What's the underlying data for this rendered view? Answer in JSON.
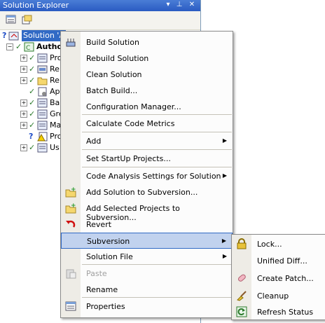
{
  "window": {
    "title": "Solution Explorer",
    "pin": "▾",
    "autohide": "⊥",
    "close": "✕"
  },
  "toolbar": {
    "properties_icon": "properties-icon",
    "show_all_icon": "show-all-files-icon"
  },
  "tree": {
    "root_label": "Solution 'A",
    "project_label": "Autho",
    "items": [
      {
        "label": "Pro",
        "icon": "properties-folder-icon",
        "expander": "+"
      },
      {
        "label": "Re",
        "icon": "references-icon",
        "expander": "+"
      },
      {
        "label": "Re",
        "icon": "folder-icon",
        "expander": "+"
      },
      {
        "label": "Ap",
        "icon": "config-file-icon",
        "expander": ""
      },
      {
        "label": "Ba",
        "icon": "class-file-icon",
        "expander": "+"
      },
      {
        "label": "Gre",
        "icon": "class-file-icon",
        "expander": "+"
      },
      {
        "label": "Ma",
        "icon": "class-file-icon",
        "expander": "+"
      },
      {
        "label": "Pro",
        "icon": "warning-file-icon",
        "expander": ""
      },
      {
        "label": "Us",
        "icon": "class-file-icon",
        "expander": "+"
      }
    ]
  },
  "context_menu": {
    "items": [
      {
        "label": "Build Solution",
        "icon": "build-icon"
      },
      {
        "label": "Rebuild Solution",
        "icon": ""
      },
      {
        "label": "Clean Solution",
        "icon": ""
      },
      {
        "label": "Batch Build...",
        "icon": ""
      },
      {
        "label": "Configuration Manager...",
        "icon": ""
      },
      {
        "label": "Calculate Code Metrics",
        "icon": ""
      },
      {
        "label": "Add",
        "icon": ""
      },
      {
        "label": "Set StartUp Projects...",
        "icon": ""
      },
      {
        "label": "Code Analysis Settings for Solution",
        "icon": ""
      },
      {
        "label": "Add Solution to Subversion...",
        "icon": "add-subversion-icon"
      },
      {
        "label": "Add Selected Projects to Subversion...",
        "icon": "add-subversion-icon"
      },
      {
        "label": "Revert",
        "icon": "revert-icon"
      },
      {
        "label": "Subversion",
        "icon": ""
      },
      {
        "label": "Solution File",
        "icon": ""
      },
      {
        "label": "Paste",
        "icon": "paste-icon"
      },
      {
        "label": "Rename",
        "icon": ""
      },
      {
        "label": "Properties",
        "icon": "properties-icon"
      }
    ]
  },
  "submenu": {
    "items": [
      {
        "label": "Lock...",
        "icon": "lock-icon"
      },
      {
        "label": "Unified Diff...",
        "icon": ""
      },
      {
        "label": "Create Patch...",
        "icon": "patch-icon"
      },
      {
        "label": "Cleanup",
        "icon": "broom-icon"
      },
      {
        "label": "Refresh Status",
        "icon": "refresh-icon"
      }
    ]
  }
}
